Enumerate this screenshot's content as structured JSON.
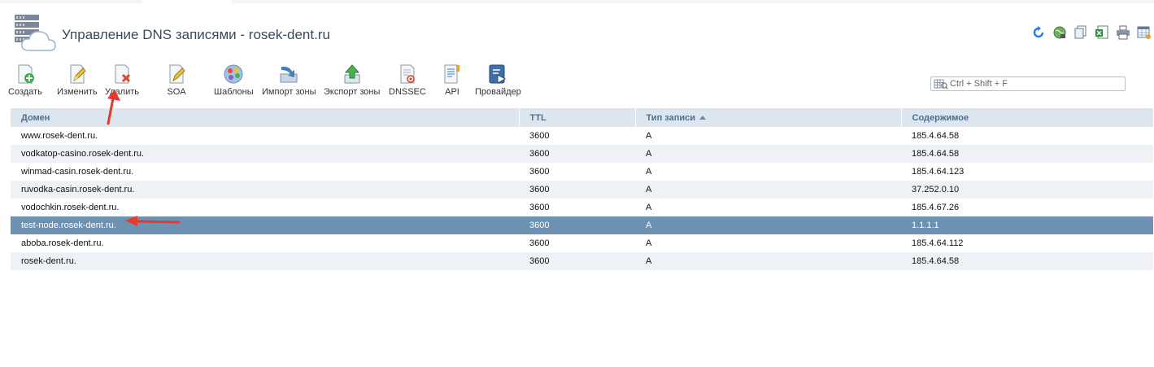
{
  "page": {
    "title": "Управление DNS записями - rosek-dent.ru"
  },
  "top_icons": [
    {
      "name": "refresh-icon"
    },
    {
      "name": "globe-icon"
    },
    {
      "name": "copy-icon"
    },
    {
      "name": "excel-export-icon"
    },
    {
      "name": "print-icon"
    },
    {
      "name": "table-settings-icon"
    }
  ],
  "toolbar": {
    "create": "Создать",
    "edit": "Изменить",
    "delete": "Удалить",
    "soa": "SOA",
    "templates": "Шаблоны",
    "import": "Импорт зоны",
    "export": "Экспорт зоны",
    "dnssec": "DNSSEC",
    "api": "API",
    "provider": "Провайдер"
  },
  "search": {
    "placeholder": "Ctrl + Shift + F"
  },
  "table": {
    "columns": [
      "Домен",
      "TTL",
      "Тип записи",
      "Содержимое"
    ],
    "sorted_column": "Тип записи",
    "sort_direction": "asc",
    "rows": [
      {
        "domain": "www.rosek-dent.ru.",
        "ttl": "3600",
        "type": "A",
        "content": "185.4.64.58",
        "selected": false
      },
      {
        "domain": "vodkatop-casino.rosek-dent.ru.",
        "ttl": "3600",
        "type": "A",
        "content": "185.4.64.58",
        "selected": false
      },
      {
        "domain": "winmad-casin.rosek-dent.ru.",
        "ttl": "3600",
        "type": "A",
        "content": "185.4.64.123",
        "selected": false
      },
      {
        "domain": "ruvodka-casin.rosek-dent.ru.",
        "ttl": "3600",
        "type": "A",
        "content": "37.252.0.10",
        "selected": false
      },
      {
        "domain": "vodochkin.rosek-dent.ru.",
        "ttl": "3600",
        "type": "A",
        "content": "185.4.67.26",
        "selected": false
      },
      {
        "domain": "test-node.rosek-dent.ru.",
        "ttl": "3600",
        "type": "A",
        "content": "1.1.1.1",
        "selected": true
      },
      {
        "domain": "aboba.rosek-dent.ru.",
        "ttl": "3600",
        "type": "A",
        "content": "185.4.64.112",
        "selected": false
      },
      {
        "domain": "rosek-dent.ru.",
        "ttl": "3600",
        "type": "A",
        "content": "185.4.64.58",
        "selected": false
      }
    ]
  },
  "colors": {
    "header_bg": "#dde6ee",
    "header_text": "#4a6f93",
    "selected_row": "#6d91b3",
    "annotation_arrow": "#e8372c"
  }
}
